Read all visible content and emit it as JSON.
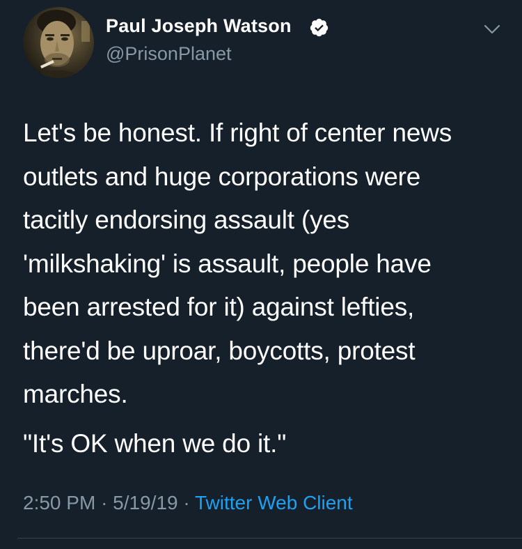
{
  "author": {
    "name": "Paul Joseph Watson",
    "handle": "@PrisonPlanet",
    "verified_icon": "verified-badge-icon",
    "avatar_icon": "profile-photo"
  },
  "menu_icon": "chevron-down-icon",
  "tweet": {
    "lines": [
      "Let's be honest. If right of center news",
      "outlets and huge corporations were",
      "tacitly endorsing assault (yes",
      "'milkshaking' is assault, people have",
      "been arrested for it) against lefties,",
      "there'd be uproar, boycotts, protest",
      "marches."
    ],
    "quote": "\"It's OK when we do it.\""
  },
  "meta": {
    "time": "2:50 PM",
    "separator": "·",
    "date": "5/19/19",
    "source": "Twitter Web Client"
  },
  "colors": {
    "background": "#15202b",
    "text": "#ffffff",
    "secondary": "#8899a6",
    "link": "#1da1f2"
  }
}
